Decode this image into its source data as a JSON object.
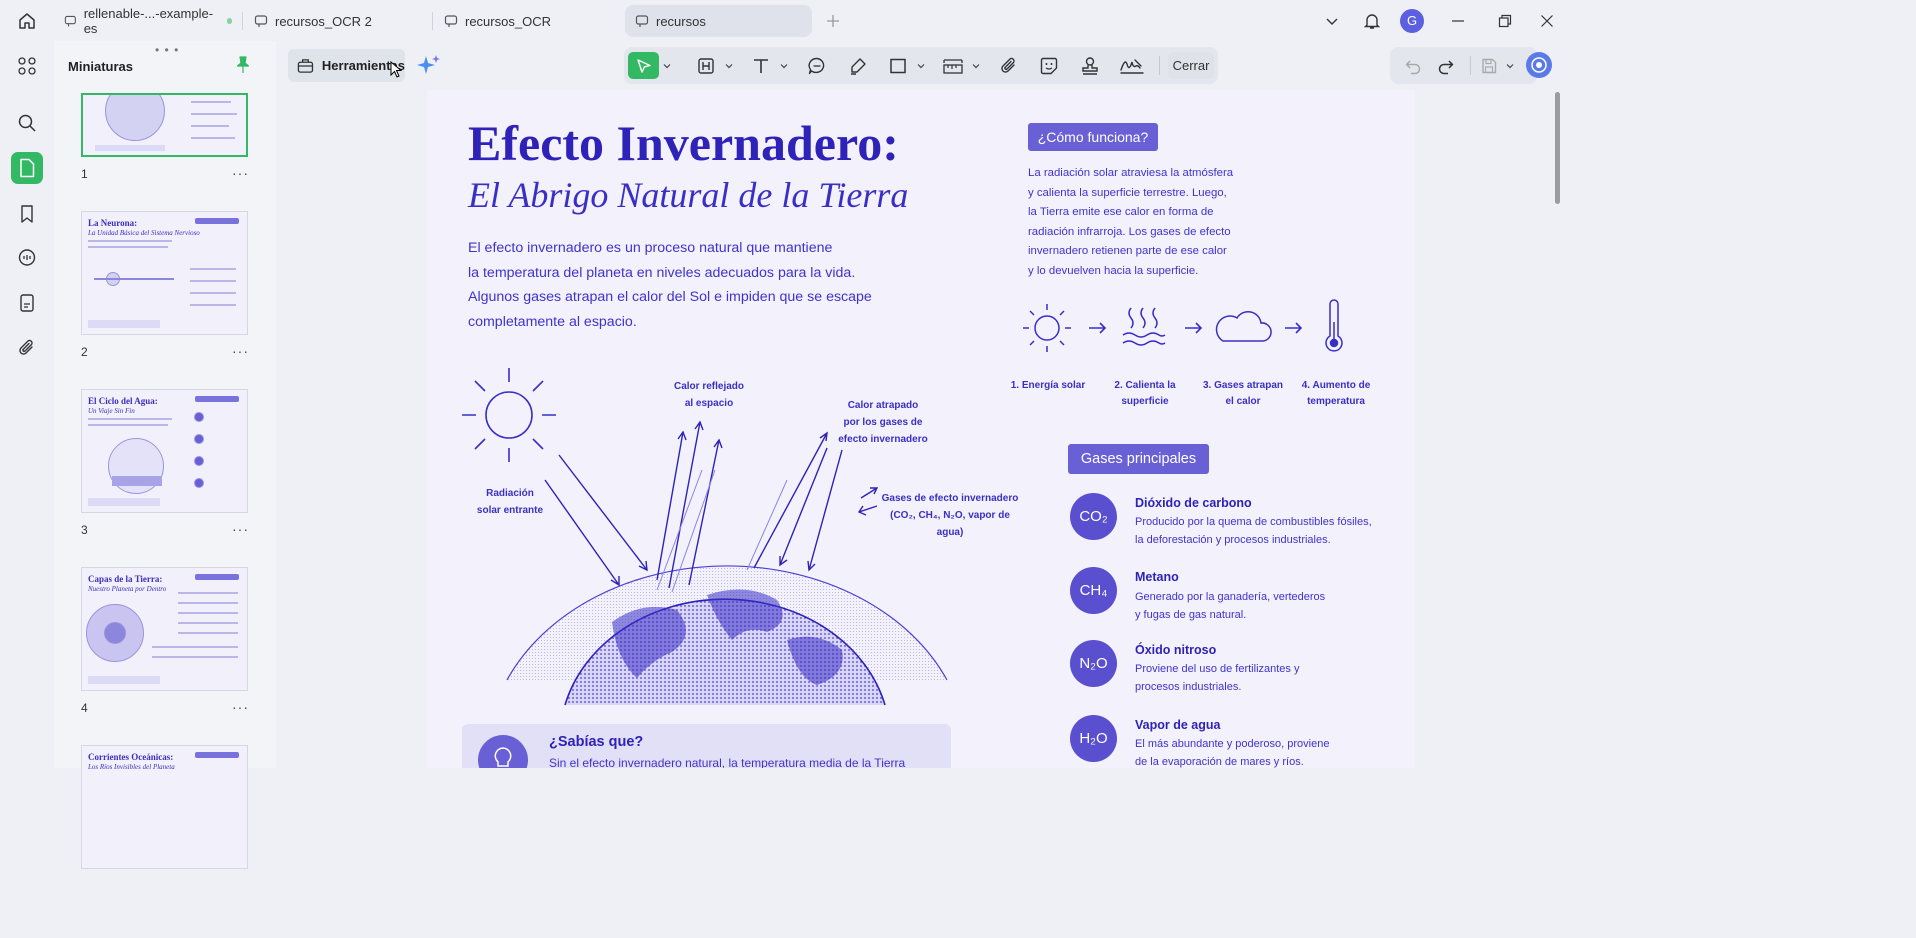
{
  "tabs": [
    {
      "label": "rellenable-...-example-es",
      "has_dot": true
    },
    {
      "label": "recursos_OCR 2"
    },
    {
      "label": "recursos_OCR"
    },
    {
      "label": "recursos",
      "active": true
    }
  ],
  "user_initial": "G",
  "sidebar": {
    "title": "Miniaturas"
  },
  "thumbnails": [
    {
      "page": "1",
      "title": "",
      "subtitle": ""
    },
    {
      "page": "2",
      "title": "La Neurona:",
      "subtitle": "La Unidad Básica del Sistema Nervioso"
    },
    {
      "page": "3",
      "title": "El Ciclo del Agua:",
      "subtitle": "Un Viaje Sin Fin"
    },
    {
      "page": "4",
      "title": "Capas de la Tierra:",
      "subtitle": "Nuestro Planeta por Dentro"
    },
    {
      "page": "",
      "title": "Corrientes Oceánicas:",
      "subtitle": "Los Ríos Invisibles del Planeta"
    }
  ],
  "toolbar": {
    "tools_label": "Herramientas",
    "close_label": "Cerrar"
  },
  "doc": {
    "title": "Efecto Invernadero:",
    "subtitle": "El Abrigo Natural de la Tierra",
    "intro_lines": [
      "El efecto invernadero es un proceso natural que mantiene",
      "la temperatura del planeta en niveles adecuados para la vida.",
      "Algunos gases atrapan el calor del Sol e impiden que se escape",
      "completamente al espacio."
    ],
    "how_title": "¿Cómo funciona?",
    "how_lines": [
      "La radiación solar atraviesa la atmósfera",
      "y calienta la superficie terrestre. Luego,",
      "la Tierra emite ese calor en forma de",
      "radiación infrarroja. Los gases de efecto",
      "invernadero retienen parte de ese calor",
      "y lo devuelven hacia la superficie."
    ],
    "steps": [
      {
        "line1": "1. Energía solar",
        "line2": ""
      },
      {
        "line1": "2. Calienta la",
        "line2": "superficie"
      },
      {
        "line1": "3. Gases atrapan",
        "line2": "el calor"
      },
      {
        "line1": "4. Aumento de",
        "line2": "temperatura"
      }
    ],
    "diagram": {
      "reflected_1": "Calor reflejado",
      "reflected_2": "al espacio",
      "trapped_1": "Calor atrapado",
      "trapped_2": "por los gases de",
      "trapped_3": "efecto invernadero",
      "incoming_1": "Radiación",
      "incoming_2": "solar entrante",
      "gases_1": "Gases de efecto invernadero",
      "gases_2": "(CO₂, CH₄, N₂O, vapor de agua)"
    },
    "gases_title": "Gases principales",
    "gases": [
      {
        "formula": "CO₂",
        "name": "Dióxido de carbono",
        "line1": "Producido por la quema de combustibles fósiles,",
        "line2": "la deforestación y procesos industriales."
      },
      {
        "formula": "CH₄",
        "name": "Metano",
        "line1": "Generado por la ganadería, vertederos",
        "line2": "y fugas de gas natural."
      },
      {
        "formula": "N₂O",
        "name": "Óxido nitroso",
        "line1": "Proviene del uso de fertilizantes y",
        "line2": "procesos industriales."
      },
      {
        "formula": "H₂O",
        "name": "Vapor de agua",
        "line1": "El más abundante y poderoso, proviene",
        "line2": "de la evaporación de mares y ríos."
      }
    ],
    "fact_title": "¿Sabías que?",
    "fact_text": "Sin el efecto invernadero natural, la temperatura media de la Tierra"
  },
  "colors": {
    "accent_green": "#33b864",
    "doc_ink": "#3a2fc4",
    "badge": "#6a60d6"
  }
}
